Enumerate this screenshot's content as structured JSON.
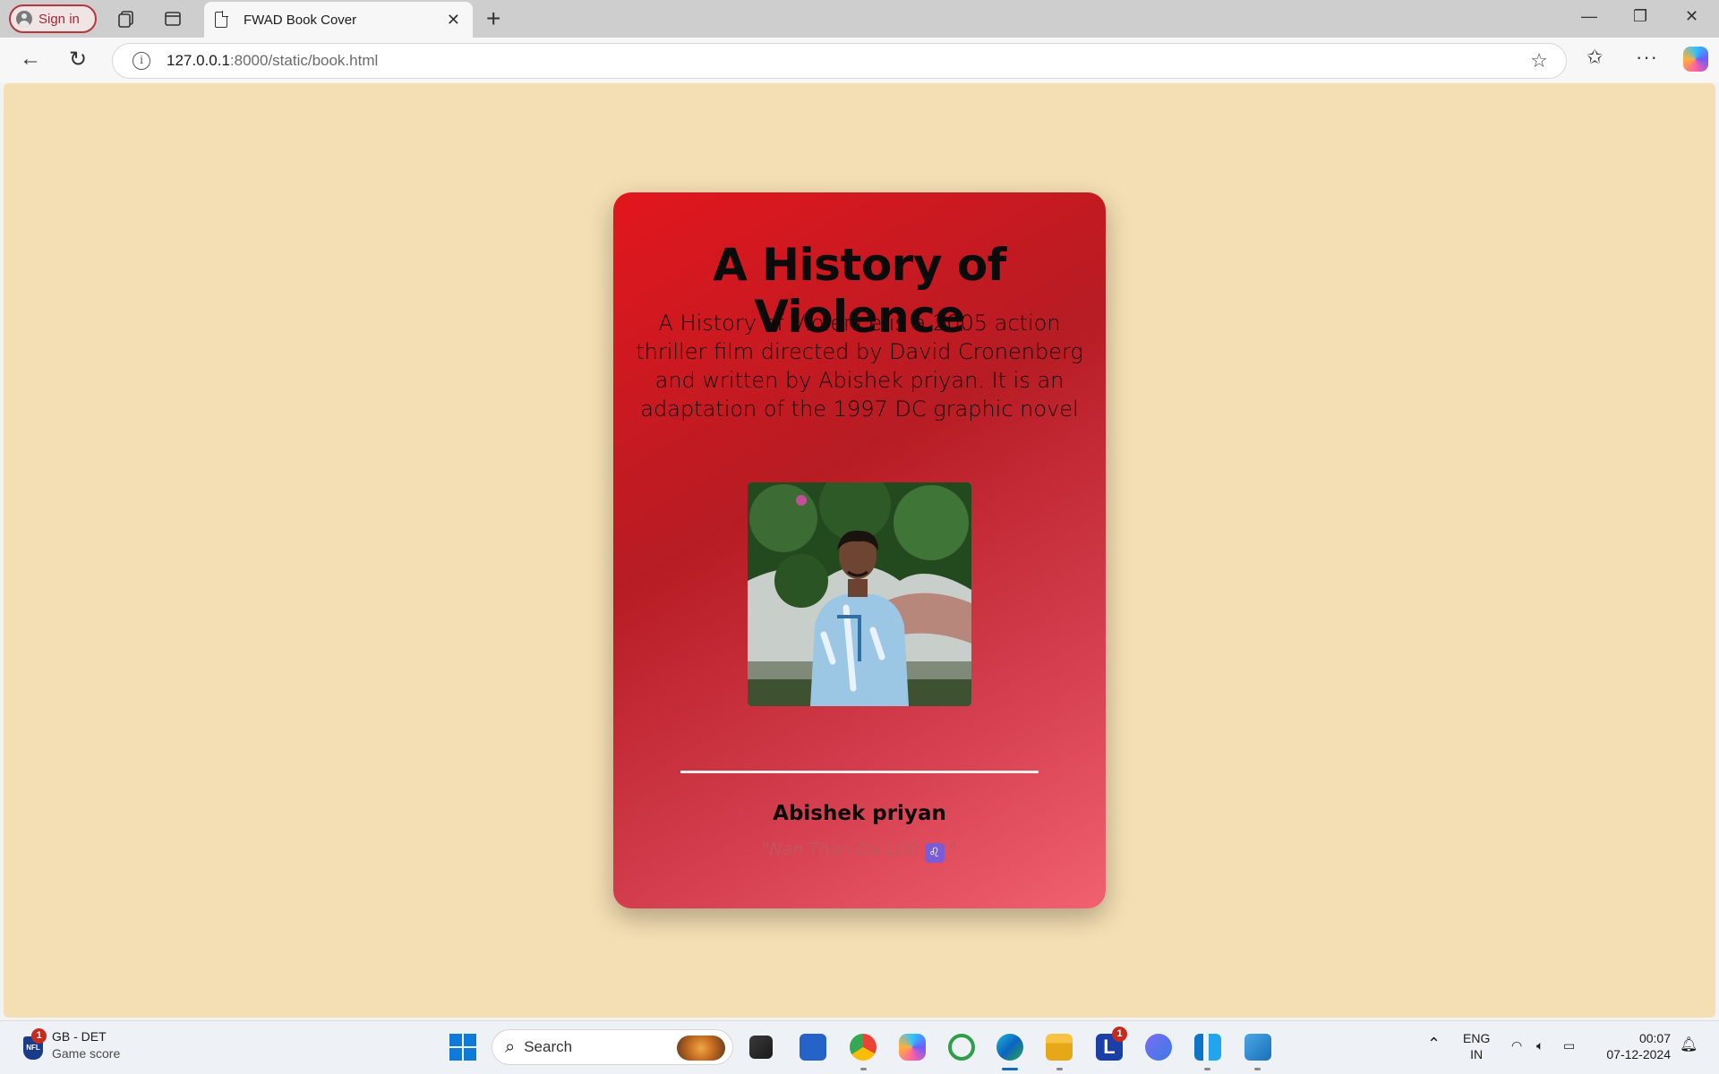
{
  "browser": {
    "signin_label": "Sign in",
    "tab_title": "FWAD Book Cover",
    "url_host": "127.0.0.1",
    "url_rest": ":8000/static/book.html"
  },
  "book": {
    "title": "A History of Violence",
    "description": "A History of Violence is a 2005 action thriller film directed by David Cronenberg and written by Abishek priyan. It is an adaptation of the 1997 DC graphic novel",
    "author": "Abishek priyan",
    "quote_open": "\"Nan Than Da LEO ",
    "quote_close": " \"",
    "quote_emoji": "♌"
  },
  "taskbar": {
    "widget_line1": "GB - DET",
    "widget_line2": "Game score",
    "widget_badge": "1",
    "widget_icon": "NFL",
    "search_label": "Search",
    "teams_badge": "1",
    "lang_line1": "ENG",
    "lang_line2": "IN",
    "time": "00:07",
    "date": "07-12-2024"
  },
  "colors": {
    "page_bg": "#f4deb3",
    "card_top": "#e2161d",
    "card_bottom": "#f1616f"
  }
}
